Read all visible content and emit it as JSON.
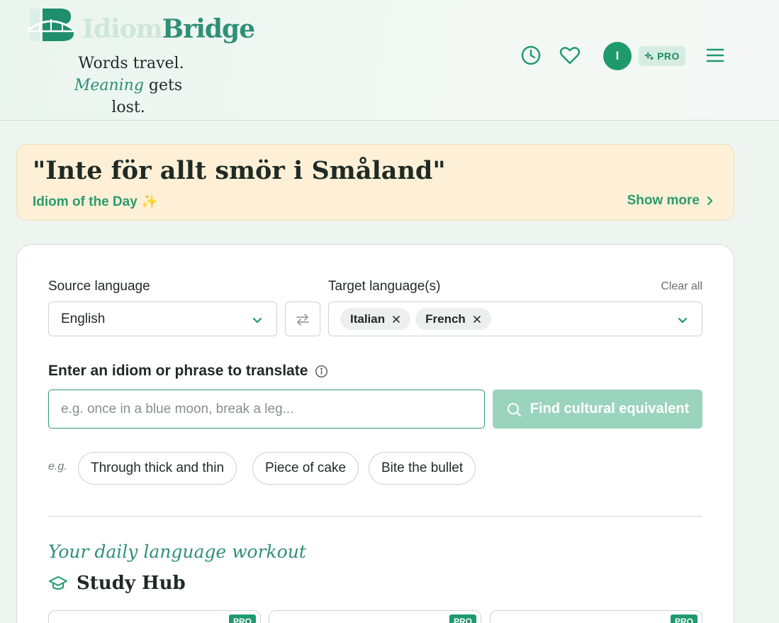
{
  "brand": {
    "name_part1": "Idiom",
    "name_part2": "Bridge",
    "tagline_line1": "Words travel.",
    "tagline_meaning": "Meaning",
    "tagline_rest": " gets lost.",
    "accent_color": "#2f8f77"
  },
  "header": {
    "avatar_initial": "I",
    "pro_label": "PRO",
    "icons": [
      "history-icon",
      "heart-icon",
      "sparkle-icon",
      "menu-icon"
    ]
  },
  "idiom_of_day": {
    "phrase": "\"Inte för allt smör i Småland\"",
    "label": "Idiom of the Day ✨",
    "show_more": "Show more"
  },
  "translator": {
    "source_label": "Source language",
    "source_value": "English",
    "target_label": "Target language(s)",
    "clear_all": "Clear all",
    "targets": [
      "Italian",
      "French"
    ],
    "phrase_label": "Enter an idiom or phrase to translate",
    "input_placeholder": "e.g. once in a blue moon, break a leg...",
    "find_button": "Find cultural equivalent",
    "eg_label": "e.g.",
    "suggestions": [
      "Through thick and thin",
      "Piece of cake",
      "Bite the bullet"
    ]
  },
  "study": {
    "workout_heading": "Your daily language workout",
    "hub_title": "Study Hub",
    "card_badge": "PRO"
  }
}
